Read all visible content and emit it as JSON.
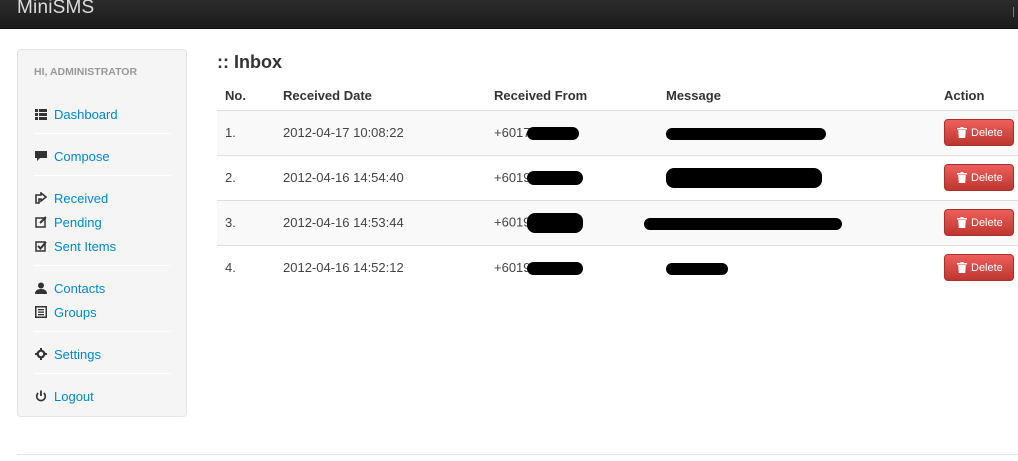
{
  "app": {
    "brand": "MiniSMS"
  },
  "sidebar": {
    "header": "HI, ADMINISTRATOR",
    "items": [
      {
        "label": "Dashboard",
        "icon": "list-icon"
      },
      {
        "label": "Compose",
        "icon": "comment-icon"
      },
      {
        "label": "Received",
        "icon": "share-icon"
      },
      {
        "label": "Pending",
        "icon": "edit-icon"
      },
      {
        "label": "Sent Items",
        "icon": "check-icon"
      },
      {
        "label": "Contacts",
        "icon": "user-icon"
      },
      {
        "label": "Groups",
        "icon": "list-alt-icon"
      },
      {
        "label": "Settings",
        "icon": "cog-icon"
      },
      {
        "label": "Logout",
        "icon": "off-icon"
      }
    ],
    "link_color": "#0088cc"
  },
  "main": {
    "title": ":: Inbox",
    "columns": [
      "No.",
      "Received Date",
      "Received From",
      "Message",
      "Action"
    ],
    "rows": [
      {
        "no": "1.",
        "date": "2012-04-17 10:08:22",
        "from": "+6017",
        "action": "Delete"
      },
      {
        "no": "2.",
        "date": "2012-04-16 14:54:40",
        "from": "+6019",
        "action": "Delete"
      },
      {
        "no": "3.",
        "date": "2012-04-16 14:53:44",
        "from": "+6019",
        "action": "Delete"
      },
      {
        "no": "4.",
        "date": "2012-04-16 14:52:12",
        "from": "+6019",
        "action": "Delete"
      }
    ],
    "delete_color": "#da4f49"
  }
}
